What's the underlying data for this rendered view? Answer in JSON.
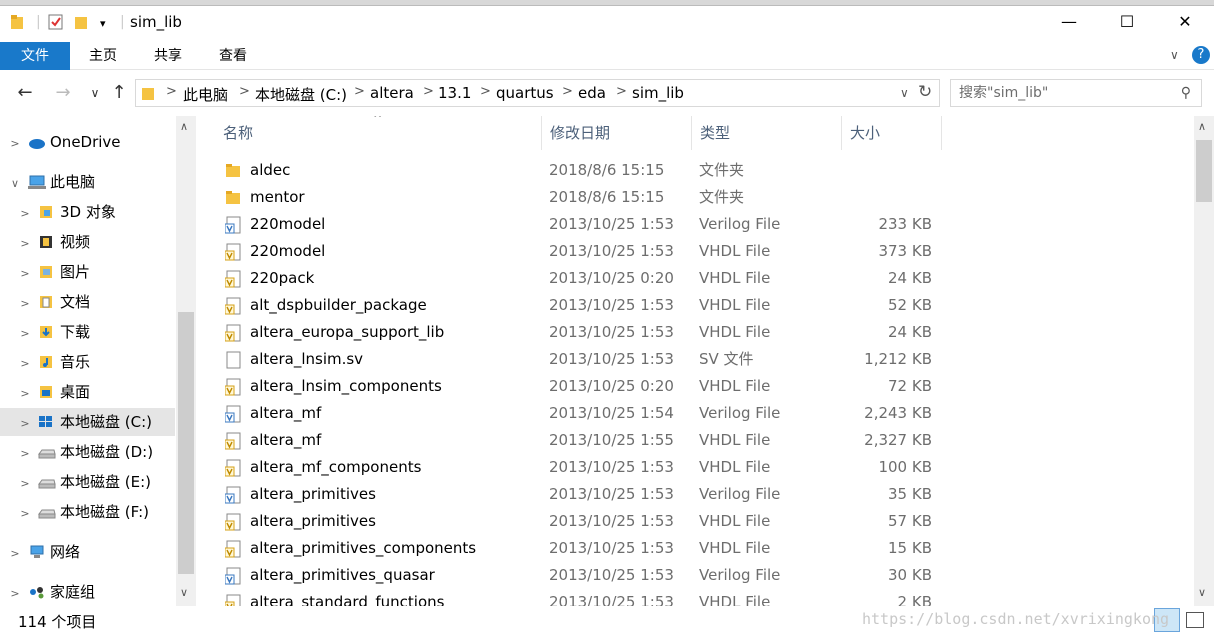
{
  "window": {
    "title": "sim_lib",
    "minimize": "—",
    "maximize": "☐",
    "close": "✕"
  },
  "ribbon": {
    "file": "文件",
    "home": "主页",
    "share": "共享",
    "view": "查看"
  },
  "address": {
    "crumbs": [
      "此电脑",
      "本地磁盘 (C:)",
      "altera",
      "13.1",
      "quartus",
      "eda",
      "sim_lib"
    ],
    "search_placeholder": "搜索\"sim_lib\""
  },
  "sidebar": {
    "items": [
      {
        "label": "OneDrive",
        "level": 0
      },
      {
        "label": "此电脑",
        "level": 0
      },
      {
        "label": "3D 对象",
        "level": 1
      },
      {
        "label": "视频",
        "level": 1
      },
      {
        "label": "图片",
        "level": 1
      },
      {
        "label": "文档",
        "level": 1
      },
      {
        "label": "下载",
        "level": 1
      },
      {
        "label": "音乐",
        "level": 1
      },
      {
        "label": "桌面",
        "level": 1
      },
      {
        "label": "本地磁盘 (C:)",
        "level": 1
      },
      {
        "label": "本地磁盘 (D:)",
        "level": 1
      },
      {
        "label": "本地磁盘 (E:)",
        "level": 1
      },
      {
        "label": "本地磁盘 (F:)",
        "level": 1
      },
      {
        "label": "网络",
        "level": 0
      },
      {
        "label": "家庭组",
        "level": 0
      }
    ]
  },
  "columns": {
    "name": "名称",
    "date": "修改日期",
    "type": "类型",
    "size": "大小"
  },
  "files": [
    {
      "name": "aldec",
      "date": "2018/8/6 15:15",
      "type": "文件夹",
      "size": "",
      "icon": "folder"
    },
    {
      "name": "mentor",
      "date": "2018/8/6 15:15",
      "type": "文件夹",
      "size": "",
      "icon": "folder"
    },
    {
      "name": "220model",
      "date": "2013/10/25 1:53",
      "type": "Verilog File",
      "size": "233 KB",
      "icon": "verilog"
    },
    {
      "name": "220model",
      "date": "2013/10/25 1:53",
      "type": "VHDL File",
      "size": "373 KB",
      "icon": "vhdl"
    },
    {
      "name": "220pack",
      "date": "2013/10/25 0:20",
      "type": "VHDL File",
      "size": "24 KB",
      "icon": "vhdl"
    },
    {
      "name": "alt_dspbuilder_package",
      "date": "2013/10/25 1:53",
      "type": "VHDL File",
      "size": "52 KB",
      "icon": "vhdl"
    },
    {
      "name": "altera_europa_support_lib",
      "date": "2013/10/25 1:53",
      "type": "VHDL File",
      "size": "24 KB",
      "icon": "vhdl"
    },
    {
      "name": "altera_lnsim.sv",
      "date": "2013/10/25 1:53",
      "type": "SV 文件",
      "size": "1,212 KB",
      "icon": "blank"
    },
    {
      "name": "altera_lnsim_components",
      "date": "2013/10/25 0:20",
      "type": "VHDL File",
      "size": "72 KB",
      "icon": "vhdl"
    },
    {
      "name": "altera_mf",
      "date": "2013/10/25 1:54",
      "type": "Verilog File",
      "size": "2,243 KB",
      "icon": "verilog"
    },
    {
      "name": "altera_mf",
      "date": "2013/10/25 1:55",
      "type": "VHDL File",
      "size": "2,327 KB",
      "icon": "vhdl"
    },
    {
      "name": "altera_mf_components",
      "date": "2013/10/25 1:53",
      "type": "VHDL File",
      "size": "100 KB",
      "icon": "vhdl"
    },
    {
      "name": "altera_primitives",
      "date": "2013/10/25 1:53",
      "type": "Verilog File",
      "size": "35 KB",
      "icon": "verilog"
    },
    {
      "name": "altera_primitives",
      "date": "2013/10/25 1:53",
      "type": "VHDL File",
      "size": "57 KB",
      "icon": "vhdl"
    },
    {
      "name": "altera_primitives_components",
      "date": "2013/10/25 1:53",
      "type": "VHDL File",
      "size": "15 KB",
      "icon": "vhdl"
    },
    {
      "name": "altera_primitives_quasar",
      "date": "2013/10/25 1:53",
      "type": "Verilog File",
      "size": "30 KB",
      "icon": "verilog"
    },
    {
      "name": "altera_standard_functions",
      "date": "2013/10/25 1:53",
      "type": "VHDL File",
      "size": "2 KB",
      "icon": "vhdl"
    }
  ],
  "status": {
    "count": "114 个项目",
    "watermark": "https://blog.csdn.net/xvrixingkong"
  },
  "colors": {
    "accent": "#1979ca",
    "folder": "#f5c342"
  }
}
